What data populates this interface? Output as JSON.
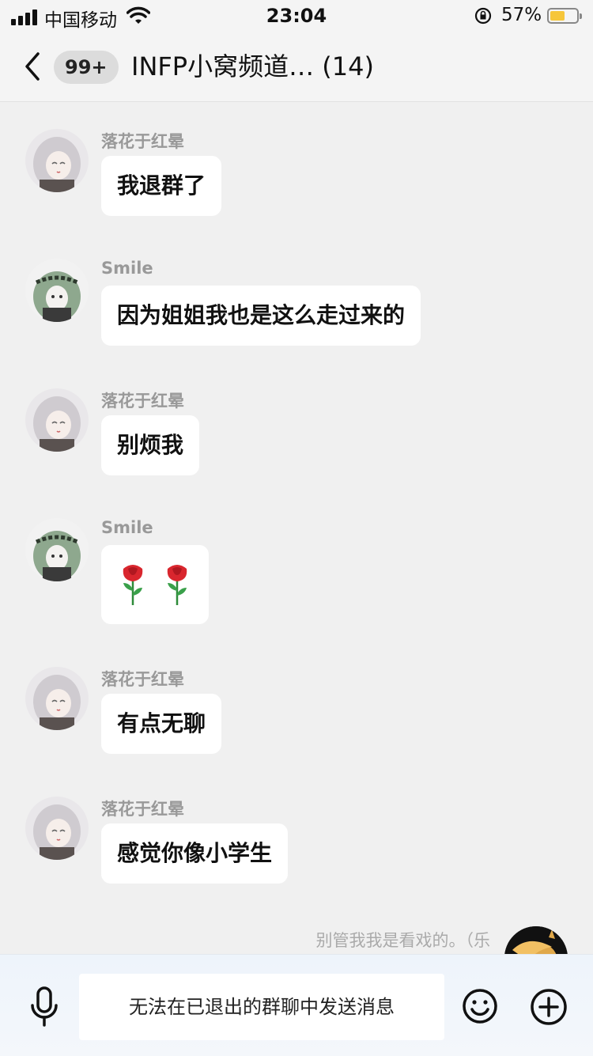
{
  "status_bar": {
    "carrier": "中国移动",
    "time": "23:04",
    "battery_percent": "57%",
    "battery_level": 0.57,
    "battery_color": "#f6c63a"
  },
  "nav": {
    "back_icon": "chevron-left-icon",
    "unread_badge": "99+",
    "title": "INFP小窝频道… (14)"
  },
  "messages": [
    {
      "sender": "落花于红晕",
      "text": "我退群了",
      "avatar": "silver-hair-girl"
    },
    {
      "sender": "Smile",
      "text": "因为姐姐我也是这么走过来的",
      "avatar": "green-hair-girl"
    },
    {
      "sender": "落花于红晕",
      "text": "别烦我",
      "avatar": "silver-hair-girl"
    },
    {
      "sender": "Smile",
      "text": "",
      "emoji": [
        "rose",
        "rose"
      ],
      "avatar": "green-hair-girl"
    },
    {
      "sender": "落花于红晕",
      "text": "有点无聊",
      "avatar": "silver-hair-girl"
    },
    {
      "sender": "落花于红晕",
      "text": "感觉你像小学生",
      "avatar": "silver-hair-girl"
    }
  ],
  "partial_message": {
    "text": "别管我我是看戏的。（乐",
    "avatar": "pony-avatar"
  },
  "input_bar": {
    "mic_icon": "microphone-icon",
    "placeholder": "无法在已退出的群聊中发送消息",
    "emoji_icon": "smiley-icon",
    "plus_icon": "plus-circle-icon"
  }
}
